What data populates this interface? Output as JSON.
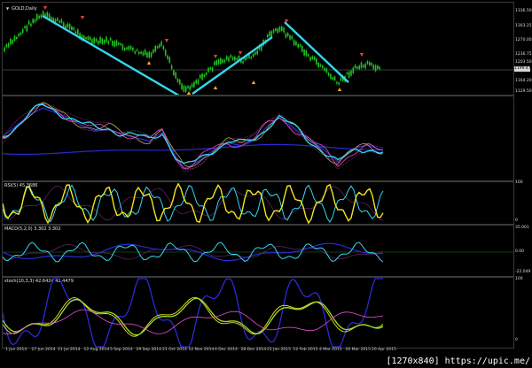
{
  "chart": {
    "symbol_label": "GOLD,Daily",
    "rsi_label": "RSI(5) 45.3686",
    "macd_label": "MACD(5,2,0) 3.302 3.302",
    "stoch_label": "stoch(10,3,3) 42.6424 42.4479"
  },
  "price_axis": [
    "1336.50",
    "1303.25",
    "1270.00",
    "1236.75",
    "1203.50",
    "1164.20",
    "1129.50"
  ],
  "current_price": "1199.47",
  "rsi_axis": [
    "100",
    "0"
  ],
  "macd_axis": [
    "35.001",
    "0.00",
    "-22.049"
  ],
  "stoch_axis": [
    "100",
    "0"
  ],
  "dates": [
    "1 Jun 2014",
    "27 Jun 2014",
    "21 Jul 2014",
    "12 Aug 2014",
    "5 Sep 2014",
    "29 Sep 2014",
    "21 Oct 2014",
    "12 Nov 2014",
    "4 Dec 2014",
    "28 Dec 2014",
    "21 Jan 2015",
    "12 Feb 2015",
    "4 Mar 2015",
    "26 Mar 2015",
    "20 Apr 2015"
  ],
  "watermark": "[1270x840] https://upic.me/",
  "colors": {
    "background": "#000000",
    "candles": "#22c322",
    "trendline": "#35d7ee",
    "up_arrow": "#f5a623",
    "down_arrow": "#e8383d",
    "grid": "#3a3a3a"
  },
  "icons": {
    "collapse": "triangle-down-icon",
    "down_marker": "down-arrow-icon",
    "up_marker": "up-arrow-icon"
  }
}
